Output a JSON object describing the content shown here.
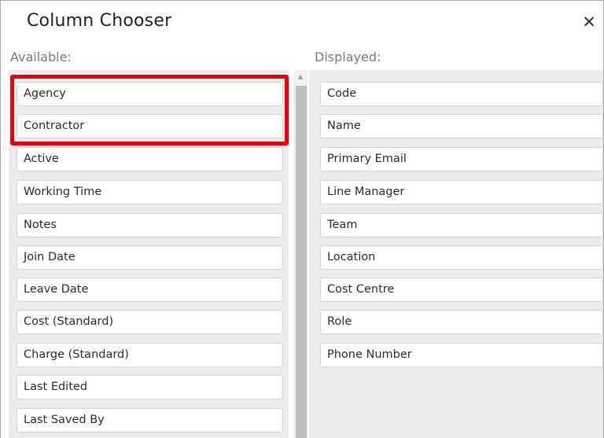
{
  "dialog": {
    "title": "Column Chooser",
    "close_glyph": "✕",
    "close_icon": "close-icon"
  },
  "available": {
    "label": "Available:",
    "items": [
      "Agency",
      "Contractor",
      "Active",
      "Working Time",
      "Notes",
      "Join Date",
      "Leave Date",
      "Cost (Standard)",
      "Charge (Standard)",
      "Last Edited",
      "Last Saved By"
    ]
  },
  "displayed": {
    "label": "Displayed:",
    "items": [
      "Code",
      "Name",
      "Primary Email",
      "Line Manager",
      "Team",
      "Location",
      "Cost Centre",
      "Role",
      "Phone Number"
    ]
  },
  "scrollbar": {
    "up_glyph": "▲",
    "up_icon": "scroll-up-arrow-icon"
  },
  "colors": {
    "highlight": "#e8000b",
    "panel_background": "#ebebeb",
    "item_border": "#d4d4d4"
  }
}
